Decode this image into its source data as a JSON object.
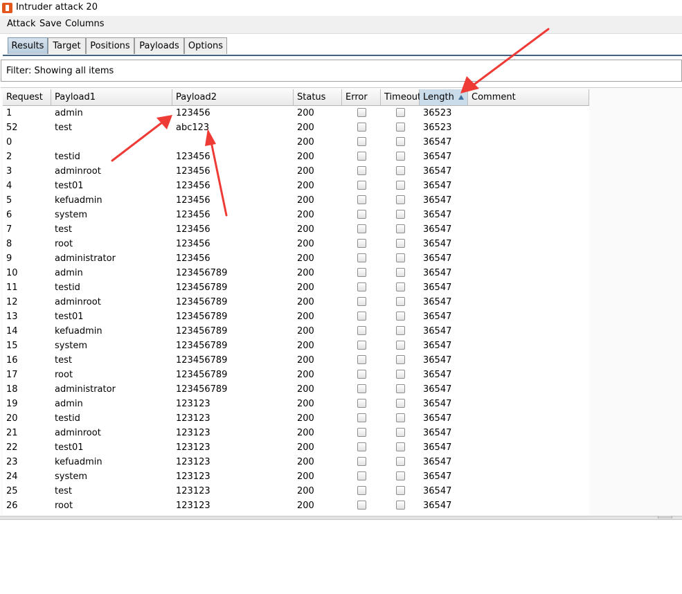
{
  "window": {
    "title": "Intruder attack 20"
  },
  "menu": [
    "Attack",
    "Save",
    "Columns"
  ],
  "tabs": [
    "Results",
    "Target",
    "Positions",
    "Payloads",
    "Options"
  ],
  "filter": {
    "text": "Filter: Showing all items"
  },
  "table": {
    "columns": [
      "Request",
      "Payload1",
      "Payload2",
      "Status",
      "Error",
      "Timeout",
      "Length",
      "Comment"
    ],
    "sort_column": "Length",
    "sort_direction": "ascending",
    "rows": [
      [
        "1",
        "admin",
        "123456",
        "200",
        false,
        false,
        "36523",
        ""
      ],
      [
        "52",
        "test",
        "abc123",
        "200",
        false,
        false,
        "36523",
        ""
      ],
      [
        "0",
        "",
        "",
        "200",
        false,
        false,
        "36547",
        ""
      ],
      [
        "2",
        "testid",
        "123456",
        "200",
        false,
        false,
        "36547",
        ""
      ],
      [
        "3",
        "adminroot",
        "123456",
        "200",
        false,
        false,
        "36547",
        ""
      ],
      [
        "4",
        "test01",
        "123456",
        "200",
        false,
        false,
        "36547",
        ""
      ],
      [
        "5",
        "kefuadmin",
        "123456",
        "200",
        false,
        false,
        "36547",
        ""
      ],
      [
        "6",
        "system",
        "123456",
        "200",
        false,
        false,
        "36547",
        ""
      ],
      [
        "7",
        "test",
        "123456",
        "200",
        false,
        false,
        "36547",
        ""
      ],
      [
        "8",
        "root",
        "123456",
        "200",
        false,
        false,
        "36547",
        ""
      ],
      [
        "9",
        "administrator",
        "123456",
        "200",
        false,
        false,
        "36547",
        ""
      ],
      [
        "10",
        "admin",
        "123456789",
        "200",
        false,
        false,
        "36547",
        ""
      ],
      [
        "11",
        "testid",
        "123456789",
        "200",
        false,
        false,
        "36547",
        ""
      ],
      [
        "12",
        "adminroot",
        "123456789",
        "200",
        false,
        false,
        "36547",
        ""
      ],
      [
        "13",
        "test01",
        "123456789",
        "200",
        false,
        false,
        "36547",
        ""
      ],
      [
        "14",
        "kefuadmin",
        "123456789",
        "200",
        false,
        false,
        "36547",
        ""
      ],
      [
        "15",
        "system",
        "123456789",
        "200",
        false,
        false,
        "36547",
        ""
      ],
      [
        "16",
        "test",
        "123456789",
        "200",
        false,
        false,
        "36547",
        ""
      ],
      [
        "17",
        "root",
        "123456789",
        "200",
        false,
        false,
        "36547",
        ""
      ],
      [
        "18",
        "administrator",
        "123456789",
        "200",
        false,
        false,
        "36547",
        ""
      ],
      [
        "19",
        "admin",
        "123123",
        "200",
        false,
        false,
        "36547",
        ""
      ],
      [
        "20",
        "testid",
        "123123",
        "200",
        false,
        false,
        "36547",
        ""
      ],
      [
        "21",
        "adminroot",
        "123123",
        "200",
        false,
        false,
        "36547",
        ""
      ],
      [
        "22",
        "test01",
        "123123",
        "200",
        false,
        false,
        "36547",
        ""
      ],
      [
        "23",
        "kefuadmin",
        "123123",
        "200",
        false,
        false,
        "36547",
        ""
      ],
      [
        "24",
        "system",
        "123123",
        "200",
        false,
        false,
        "36547",
        ""
      ],
      [
        "25",
        "test",
        "123123",
        "200",
        false,
        false,
        "36547",
        ""
      ],
      [
        "26",
        "root",
        "123123",
        "200",
        false,
        false,
        "36547",
        ""
      ]
    ]
  },
  "colors": {
    "annotation_arrow": "#ef3b36",
    "active_tab": "#b7cbdc",
    "sorted_header": "#cadbea"
  }
}
